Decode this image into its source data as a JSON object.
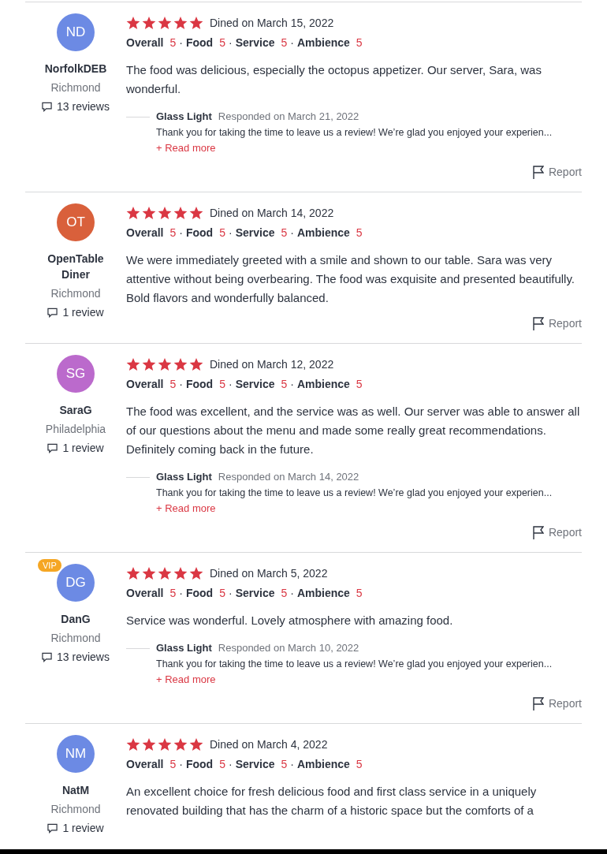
{
  "reviews": [
    {
      "initials": "ND",
      "color": "#6c8ae4",
      "name": "NorfolkDEB",
      "location": "Richmond",
      "review_count": "13 reviews",
      "stars": 5,
      "dined": "Dined on March 15, 2022",
      "ratings": [
        {
          "label": "Overall",
          "value": "5"
        },
        {
          "sep": "·",
          "label": "Food",
          "value": "5"
        },
        {
          "sep": "·",
          "label": "Service",
          "value": "5"
        },
        {
          "sep": "·",
          "label": "Ambience",
          "value": "5"
        }
      ],
      "text": "The food was delicious, especially the octopus appetizer. Our server, Sara, was wonderful.",
      "response": {
        "author": "Glass Light",
        "date": "Responded on March 21, 2022",
        "text": "Thank you for taking the time to leave us a review! We’re glad you enjoyed your experien...",
        "more": "+ Read more"
      },
      "report": "Report"
    },
    {
      "initials": "OT",
      "color": "#d9603b",
      "name": "OpenTable Diner",
      "location": "Richmond",
      "review_count": "1 review",
      "stars": 5,
      "dined": "Dined on March 14, 2022",
      "ratings": [
        {
          "label": "Overall",
          "value": "5"
        },
        {
          "sep": "·",
          "label": "Food",
          "value": "5"
        },
        {
          "sep": "·",
          "label": "Service",
          "value": "5"
        },
        {
          "sep": "·",
          "label": "Ambience",
          "value": "5"
        }
      ],
      "text": "We were immediately greeted with a smile and shown to our table. Sara was very attentive without being overbearing. The food was exquisite and presented beautifully. Bold flavors and wonderfully balanced.",
      "report": "Report"
    },
    {
      "initials": "SG",
      "color": "#bb6acc",
      "name": "SaraG",
      "location": "Philadelphia",
      "review_count": "1 review",
      "stars": 5,
      "dined": "Dined on March 12, 2022",
      "ratings": [
        {
          "label": "Overall",
          "value": "5"
        },
        {
          "sep": "·",
          "label": "Food",
          "value": "5"
        },
        {
          "sep": "·",
          "label": "Service",
          "value": "5"
        },
        {
          "sep": "·",
          "label": "Ambience",
          "value": "5"
        }
      ],
      "text": "The food was excellent, and the service was as well. Our server was able to answer all of our questions about the menu and made some really great recommendations. Definitely coming back in the future.",
      "response": {
        "author": "Glass Light",
        "date": "Responded on March 14, 2022",
        "text": "Thank you for taking the time to leave us a review! We’re glad you enjoyed your experien...",
        "more": "+ Read more"
      },
      "report": "Report"
    },
    {
      "initials": "DG",
      "color": "#6c8ae4",
      "badge": "VIP",
      "name": "DanG",
      "location": "Richmond",
      "review_count": "13 reviews",
      "stars": 5,
      "dined": "Dined on March 5, 2022",
      "ratings": [
        {
          "label": "Overall",
          "value": "5"
        },
        {
          "sep": "·",
          "label": "Food",
          "value": "5"
        },
        {
          "sep": "·",
          "label": "Service",
          "value": "5"
        },
        {
          "sep": "·",
          "label": "Ambience",
          "value": "5"
        }
      ],
      "text": "Service was wonderful. Lovely atmosphere with amazing food.",
      "response": {
        "author": "Glass Light",
        "date": "Responded on March 10, 2022",
        "text": "Thank you for taking the time to leave us a review! We’re glad you enjoyed your experien...",
        "more": "+ Read more"
      },
      "report": "Report"
    },
    {
      "initials": "NM",
      "color": "#6c8ae4",
      "name": "NatM",
      "location": "Richmond",
      "review_count": "1 review",
      "stars": 5,
      "dined": "Dined on March 4, 2022",
      "ratings": [
        {
          "label": "Overall",
          "value": "5"
        },
        {
          "sep": "·",
          "label": "Food",
          "value": "5"
        },
        {
          "sep": "·",
          "label": "Service",
          "value": "5"
        },
        {
          "sep": "·",
          "label": "Ambience",
          "value": "5"
        }
      ],
      "text": "An excellent choice for fresh delicious food and first class service in a uniquely renovated building that has the charm of a historic space but the comforts of a"
    }
  ]
}
